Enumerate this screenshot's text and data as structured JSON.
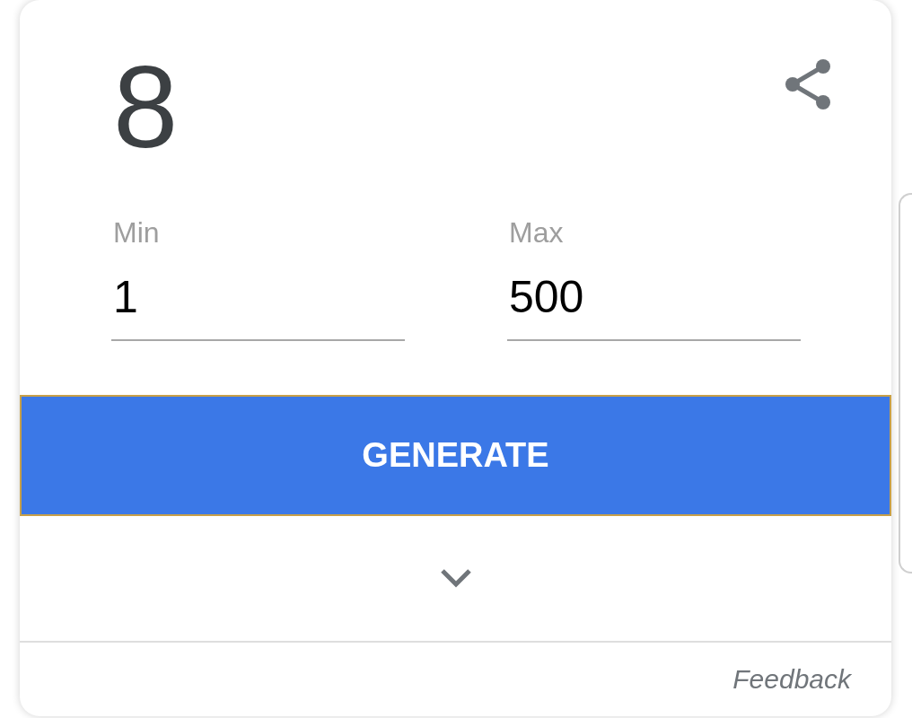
{
  "result": {
    "value": "8"
  },
  "fields": [
    {
      "label": "Min",
      "value": "1"
    },
    {
      "label": "Max",
      "value": "500"
    }
  ],
  "generate_button": {
    "label": "GENERATE",
    "focused": true
  },
  "expand_toggle": {
    "expanded": false
  },
  "footer": {
    "link": "Feedback"
  }
}
